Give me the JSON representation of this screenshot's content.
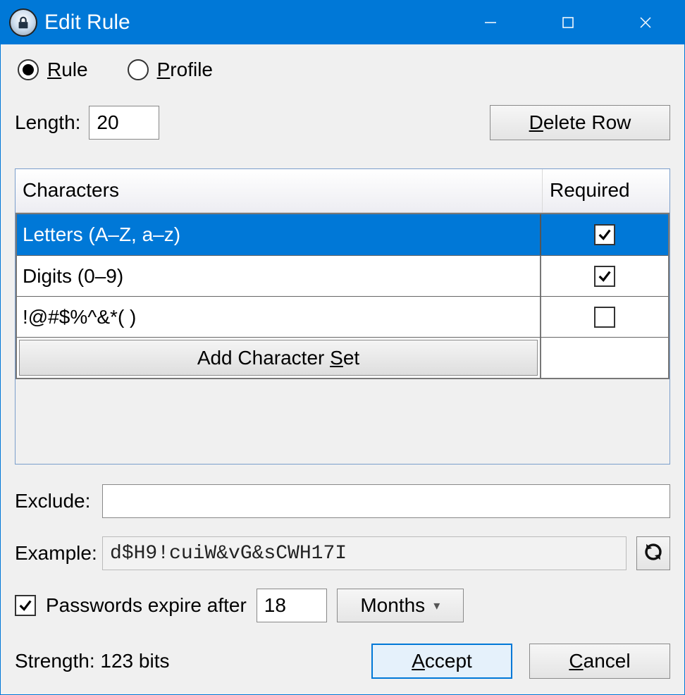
{
  "titlebar": {
    "title": "Edit Rule"
  },
  "mode": {
    "rule_label": "Rule",
    "profile_label": "Profile",
    "selected": "rule"
  },
  "length": {
    "label": "Length:",
    "value": "20"
  },
  "buttons": {
    "delete_row": "Delete Row",
    "add_charset_pre": "Add Character ",
    "add_charset_ul": "S",
    "add_charset_post": "et",
    "accept": "Accept",
    "cancel": "Cancel"
  },
  "table": {
    "header_chars": "Characters",
    "header_required": "Required",
    "rows": [
      {
        "chars": "Letters (A–Z, a–z)",
        "required": true,
        "selected": true
      },
      {
        "chars": "Digits (0–9)",
        "required": true,
        "selected": false
      },
      {
        "chars": " !@#$%^&*( )",
        "required": false,
        "selected": false
      }
    ]
  },
  "exclude": {
    "label": "Exclude:",
    "value": ""
  },
  "example": {
    "label": "Example:",
    "value": "d$H9!cuiW&vG&sCWH17I"
  },
  "expire": {
    "enabled": true,
    "label_text": "Passwords expire after",
    "value": "18",
    "unit": "Months"
  },
  "strength": {
    "text": "Strength: 123 bits"
  }
}
